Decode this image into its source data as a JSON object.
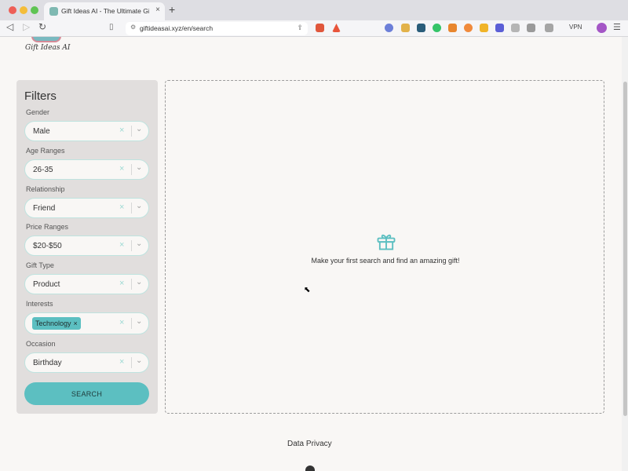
{
  "browser": {
    "tab_title": "Gift Ideas AI - The Ultimate Gift",
    "tab_close": "×",
    "new_tab": "+",
    "url": "giftideasai.xyz/en/search",
    "vpn_label": "VPN"
  },
  "site": {
    "logo_text": "Gift Ideas AI"
  },
  "filters": {
    "title": "Filters",
    "fields": [
      {
        "label": "Gender",
        "value": "Male"
      },
      {
        "label": "Age Ranges",
        "value": "26-35"
      },
      {
        "label": "Relationship",
        "value": "Friend"
      },
      {
        "label": "Price Ranges",
        "value": "$20-$50"
      },
      {
        "label": "Gift Type",
        "value": "Product"
      },
      {
        "label": "Interests",
        "tags": [
          "Technology"
        ]
      },
      {
        "label": "Occasion",
        "value": "Birthday"
      }
    ],
    "clear_glyph": "×",
    "search_label": "SEARCH"
  },
  "results": {
    "empty_message": "Make your first search and find an amazing gift!"
  },
  "footer": {
    "data_privacy": "Data Privacy"
  },
  "colors": {
    "accent": "#5cbfc1",
    "panel": "#e1dedd",
    "page_bg": "#f9f7f5"
  }
}
